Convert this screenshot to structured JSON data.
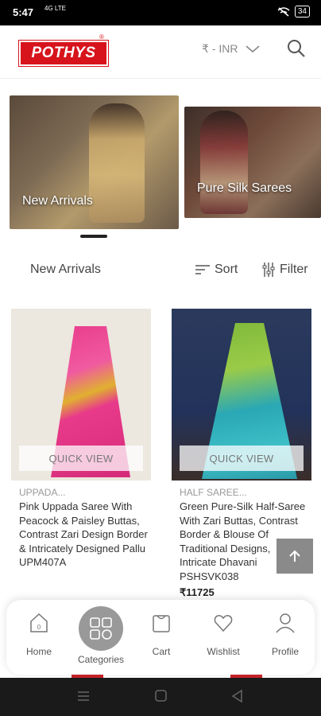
{
  "status_bar": {
    "time": "5:47",
    "signal_text": "4G LTE",
    "battery": "34"
  },
  "header": {
    "logo_text": "POTHYS",
    "logo_reg": "®",
    "currency": "₹ - INR",
    "icons": [
      "search-icon",
      "chevron-down-icon"
    ]
  },
  "banners": [
    {
      "label": "New Arrivals"
    },
    {
      "label": "Pure Silk Sarees"
    }
  ],
  "toolbar": {
    "section_title": "New Arrivals",
    "sort_label": "Sort",
    "filter_label": "Filter"
  },
  "products": [
    {
      "quick_view": "QUICK VIEW",
      "category": "UPPADA...",
      "name": "Pink Uppada Saree With Peacock & Paisley Buttas, Contrast Zari Design Border & Intricately Designed Pallu UPM407A",
      "price": ""
    },
    {
      "quick_view": "QUICK VIEW",
      "category": "HALF SAREE...",
      "name": "Green Pure-Silk Half-Saree With Zari Buttas, Contrast Border & Blouse Of Traditional Designs, Intricate Dhavani PSHSVK038",
      "price": "₹11725"
    }
  ],
  "scroll_top_icon": "arrow-up-icon",
  "bottom_nav": {
    "home": "Home",
    "categories": "Categories",
    "cart": "Cart",
    "wishlist": "Wishlist",
    "profile": "Profile",
    "cart_count": "0"
  },
  "colors": {
    "brand_red": "#d7141b",
    "nav_bubble": "#999999"
  }
}
